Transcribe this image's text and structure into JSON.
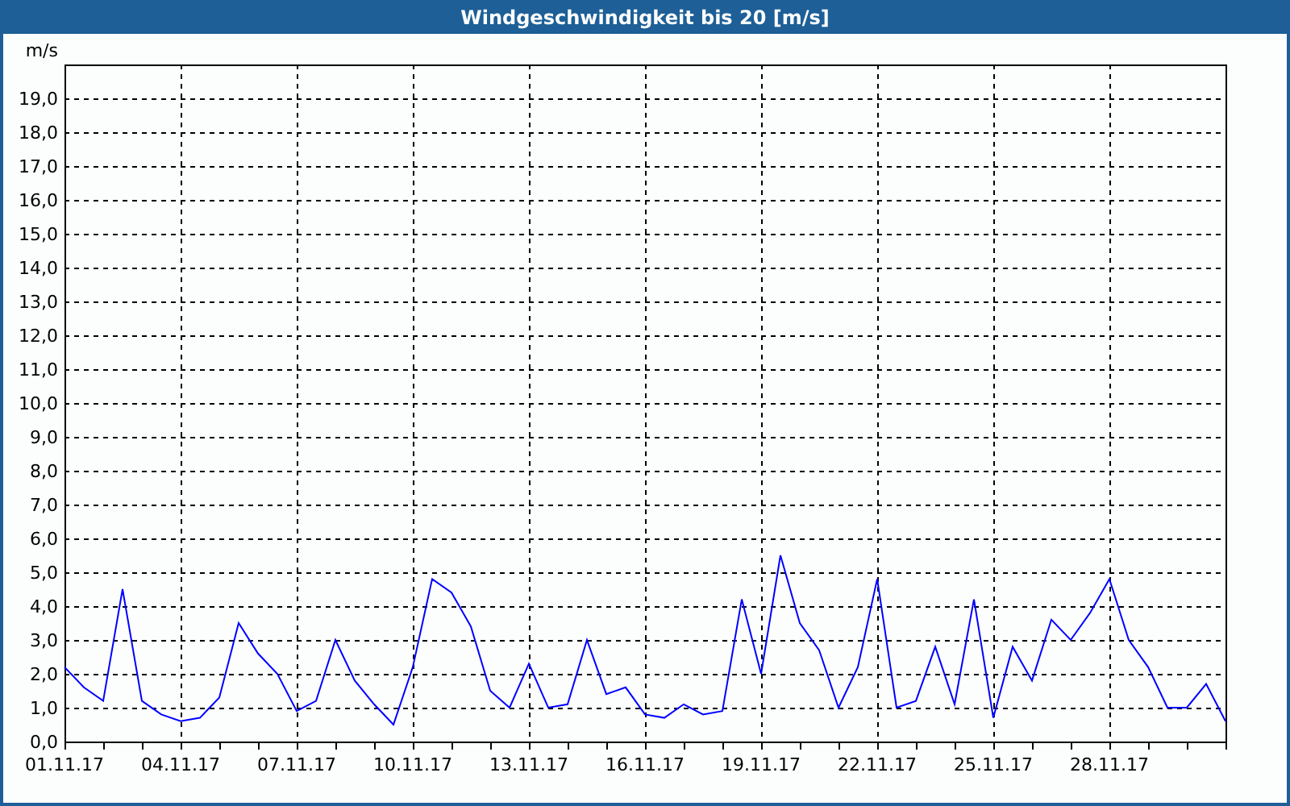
{
  "window": {
    "title": "Windgeschwindigkeit bis 20 [m/s]"
  },
  "chart": {
    "chart_data": {
      "type": "line",
      "ylabel": "m/s",
      "categories": [
        "01.11.17",
        null,
        null,
        null,
        null,
        null,
        "04.11.17",
        null,
        null,
        null,
        null,
        null,
        "07.11.17",
        null,
        null,
        null,
        null,
        null,
        "10.11.17",
        null,
        null,
        null,
        null,
        null,
        "13.11.17",
        null,
        null,
        null,
        null,
        null,
        "16.11.17",
        null,
        null,
        null,
        null,
        null,
        "19.11.17",
        null,
        null,
        null,
        null,
        null,
        "22.11.17",
        null,
        null,
        null,
        null,
        null,
        "25.11.17",
        null,
        null,
        null,
        null,
        null,
        "28.11.17",
        null,
        null,
        null,
        null,
        null,
        null
      ],
      "series": [
        {
          "color": "#0000ff",
          "values": [
            2.2,
            1.6,
            1.2,
            4.5,
            1.2,
            0.8,
            0.6,
            0.7,
            1.3,
            3.5,
            2.6,
            2.0,
            0.9,
            1.2,
            3.0,
            1.8,
            1.1,
            0.5,
            2.2,
            4.8,
            4.4,
            3.4,
            1.5,
            1.0,
            2.3,
            1.0,
            1.1,
            3.0,
            1.4,
            1.6,
            0.8,
            0.7,
            1.1,
            0.8,
            0.9,
            4.2,
            2.0,
            5.5,
            3.5,
            2.7,
            1.0,
            2.2,
            4.8,
            1.0,
            1.2,
            2.8,
            1.1,
            4.2,
            0.7,
            2.8,
            1.8,
            3.6,
            3.0,
            3.8,
            4.8,
            3.0,
            2.2,
            1.0,
            1.0,
            1.7,
            0.6
          ]
        }
      ],
      "ylim": [
        0,
        20
      ],
      "grid": true,
      "yticks": [
        {
          "value": 0,
          "label": "0,0"
        },
        {
          "value": 1,
          "label": "1,0"
        },
        {
          "value": 2,
          "label": "2,0"
        },
        {
          "value": 3,
          "label": "3,0"
        },
        {
          "value": 4,
          "label": "4,0"
        },
        {
          "value": 5,
          "label": "5,0"
        },
        {
          "value": 6,
          "label": "6,0"
        },
        {
          "value": 7,
          "label": "7,0"
        },
        {
          "value": 8,
          "label": "8,0"
        },
        {
          "value": 9,
          "label": "9,0"
        },
        {
          "value": 10,
          "label": "10,0"
        },
        {
          "value": 11,
          "label": "11,0"
        },
        {
          "value": 12,
          "label": "12,0"
        },
        {
          "value": 13,
          "label": "13,0"
        },
        {
          "value": 14,
          "label": "14,0"
        },
        {
          "value": 15,
          "label": "15,0"
        },
        {
          "value": 16,
          "label": "16,0"
        },
        {
          "value": 17,
          "label": "17,0"
        },
        {
          "value": 18,
          "label": "18,0"
        },
        {
          "value": 19,
          "label": "19,0"
        }
      ]
    }
  }
}
